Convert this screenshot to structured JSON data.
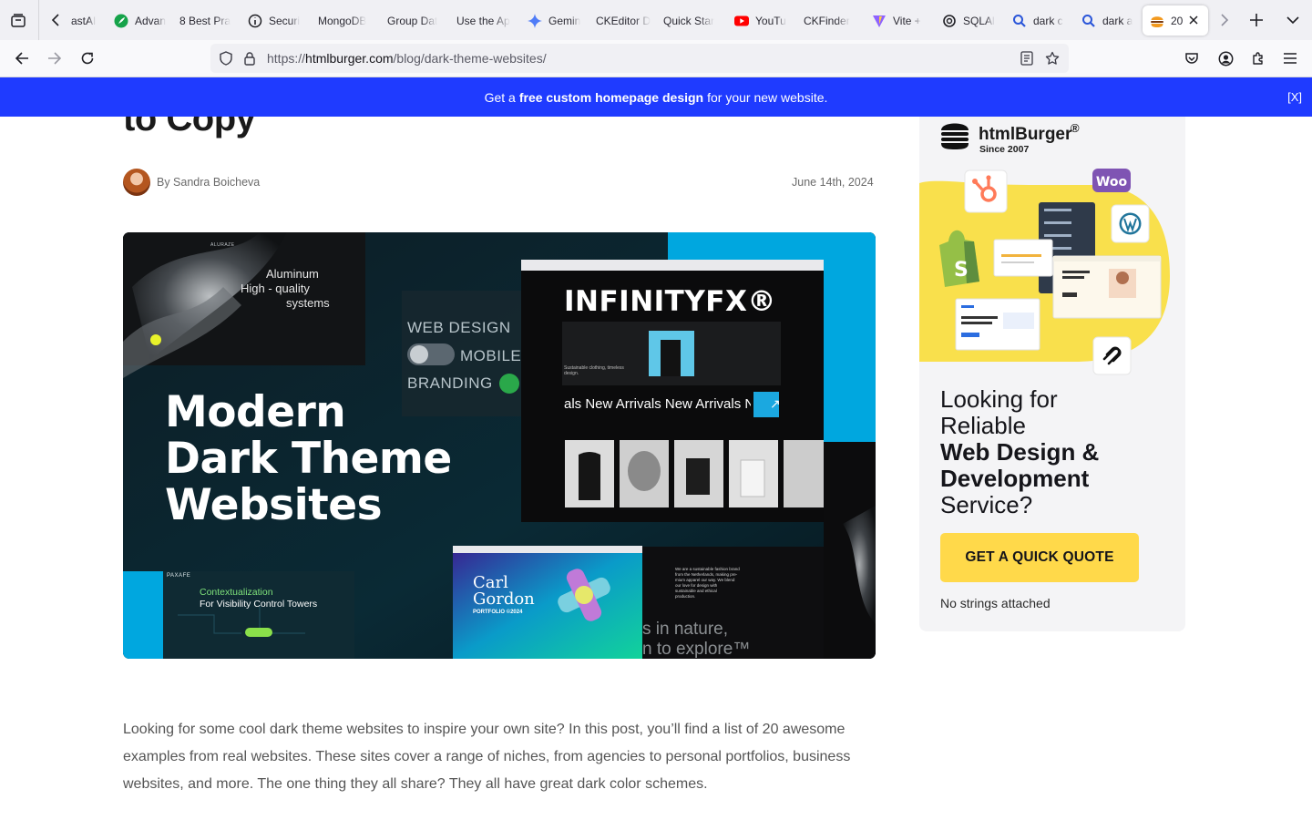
{
  "browser": {
    "tabs": [
      {
        "label": "astAI",
        "icon": "none"
      },
      {
        "label": "Advan",
        "icon": "feather-icon"
      },
      {
        "label": "8 Best Pra",
        "icon": "none"
      },
      {
        "label": "Securi",
        "icon": "info-icon"
      },
      {
        "label": "MongoDB",
        "icon": "none"
      },
      {
        "label": "Group Dat",
        "icon": "none"
      },
      {
        "label": "Use the Ap",
        "icon": "none"
      },
      {
        "label": "Gemin",
        "icon": "gemini-icon"
      },
      {
        "label": "CKEditor D",
        "icon": "none"
      },
      {
        "label": "Quick Star",
        "icon": "none"
      },
      {
        "label": "YouTu",
        "icon": "youtube-icon"
      },
      {
        "label": "CKFinder",
        "icon": "none"
      },
      {
        "label": "Vite +",
        "icon": "vite-icon"
      },
      {
        "label": "SQLAl",
        "icon": "openai-icon"
      },
      {
        "label": "dark c",
        "icon": "search-icon"
      },
      {
        "label": "dark a",
        "icon": "search-icon"
      },
      {
        "label": "20",
        "icon": "burger-icon"
      }
    ],
    "url": {
      "prefix": "https://",
      "domain": "htmlburger.com",
      "path": "/blog/dark-theme-websites/"
    }
  },
  "promo": {
    "pre": "Get a",
    "bold": "free custom homepage design",
    "post": "for your new website.",
    "close": "[X]"
  },
  "article": {
    "title_tail": "to Copy",
    "author": "By Sandra Boicheva",
    "date": "June 14th, 2024",
    "body": "Looking for some cool dark theme websites to inspire your own site? In this post, you’ll find a list of 20 awesome examples from real websites. These sites cover a range of niches, from agencies to personal portfolios, business websites, and more. The one thing they all share? They all have great dark color schemes."
  },
  "hero": {
    "headline": [
      "Modern",
      "Dark Theme",
      "Websites"
    ],
    "brand": "INFINITYFX®",
    "ticker": "als New Arrivals New Arrivals Ne",
    "aluminum": [
      "Aluminum",
      "High - quality",
      "systems"
    ],
    "services": [
      "WEB DESIGN",
      "MOBILE",
      "BRANDING"
    ],
    "carl": [
      "Carl",
      "Gordon"
    ],
    "portfolio": "PORTFOLIO ©2024",
    "paxafe_logo": "PAXAFE",
    "paxafe": [
      "Contextualization",
      "For Visibility Control Towers"
    ],
    "nature": [
      "s in nature,",
      "n to explore™"
    ],
    "sustain": "Sustainable clothing, timeless design.",
    "aluraze": "ALURAZE",
    "fashion_blurb": [
      "We are a sustainable fashion brand",
      "from the Netherlands, making pre-",
      "mium apparel our way. We blend",
      "our love for design with",
      "sustainable and ethical",
      "production."
    ]
  },
  "ad": {
    "brand": "htmlBurger",
    "reg": "®",
    "since": "Since 2007",
    "woo": "Woo",
    "heading_lines": [
      {
        "text": "Looking for",
        "bold": false
      },
      {
        "text": "Reliable",
        "bold": false
      },
      {
        "text": "Web Design &",
        "bold": true
      },
      {
        "text": "Development",
        "bold": true
      },
      {
        "text": "Service?",
        "bold": false
      }
    ],
    "cta": "GET A QUICK QUOTE",
    "note": "No strings attached"
  },
  "colors": {
    "promo_bg": "#1f3bff",
    "cta_bg": "#ffd94a",
    "ad_yellow": "#f9e04c",
    "hero_cyan": "#00b3ea"
  }
}
